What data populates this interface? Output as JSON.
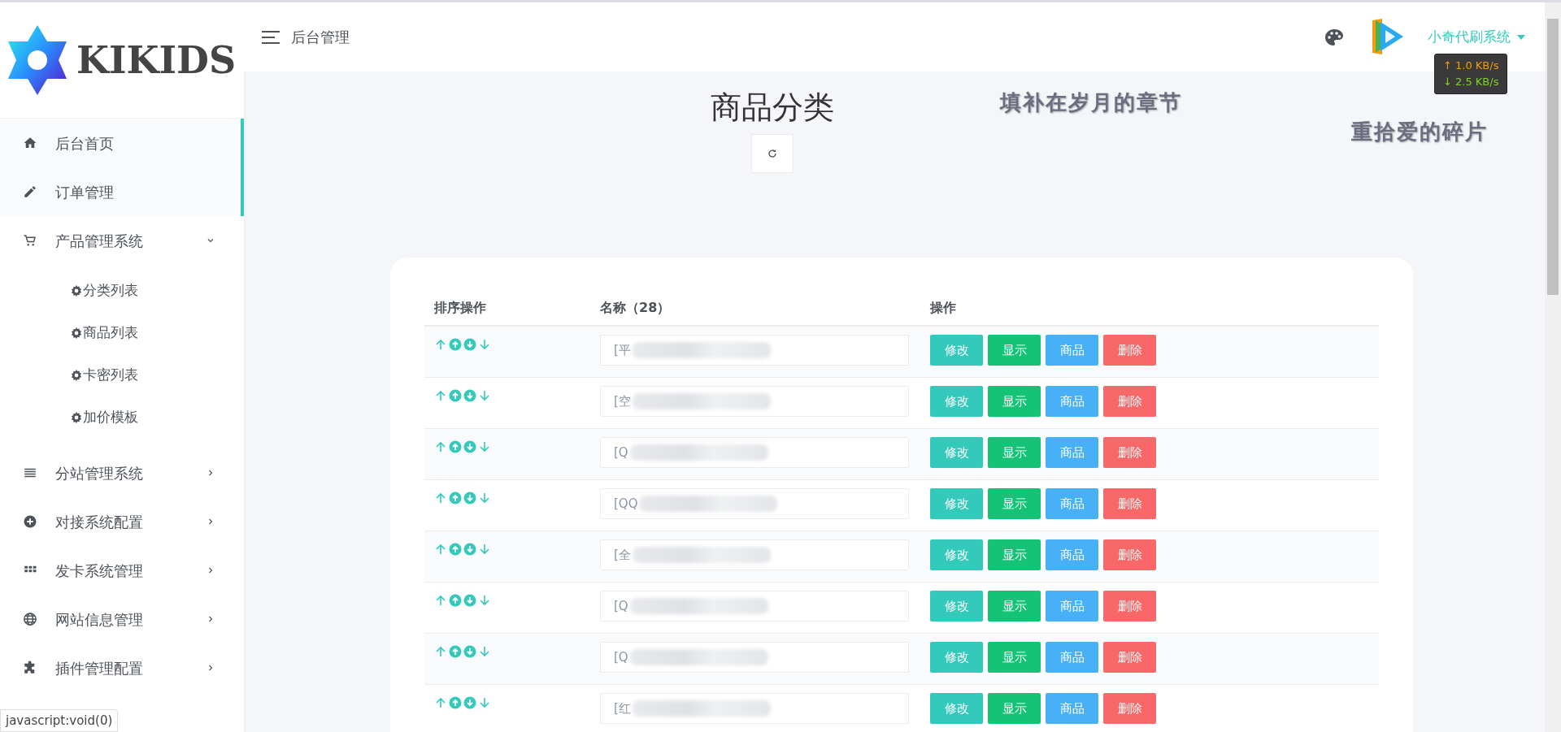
{
  "sidebar": {
    "logo": "KIKIDS",
    "items": [
      {
        "label": "后台首页",
        "selected": true
      },
      {
        "label": "订单管理",
        "selected": true
      },
      {
        "label": "产品管理系统",
        "selected": false,
        "expanded": true,
        "children": [
          {
            "label": "分类列表"
          },
          {
            "label": "商品列表"
          },
          {
            "label": "卡密列表"
          },
          {
            "label": "加价模板"
          }
        ]
      },
      {
        "label": "分站管理系统",
        "selected": false,
        "expanded": false
      },
      {
        "label": "对接系统配置",
        "selected": false,
        "expanded": false
      },
      {
        "label": "发卡系统管理",
        "selected": false,
        "expanded": false
      },
      {
        "label": "网站信息管理",
        "selected": false,
        "expanded": false
      },
      {
        "label": "插件管理配置",
        "selected": false,
        "expanded": false
      }
    ]
  },
  "header": {
    "title": "后台管理",
    "user": "小奇代刷系统"
  },
  "net_speed": {
    "upload": "↑ 1.0 KB/s",
    "download": "↓ 2.5 KB/s"
  },
  "page": {
    "title": "商品分类",
    "floating_texts": [
      "填补在岁月的章节",
      "重拾爱的碎片"
    ]
  },
  "table": {
    "columns": [
      "排序操作",
      "名称（28）",
      "操作"
    ],
    "rows": [
      {
        "name": "[平",
        "actions": [
          "修改",
          "显示",
          "商品",
          "删除"
        ]
      },
      {
        "name": "[空",
        "actions": [
          "修改",
          "显示",
          "商品",
          "删除"
        ]
      },
      {
        "name": "[Q",
        "actions": [
          "修改",
          "显示",
          "商品",
          "删除"
        ]
      },
      {
        "name": "[QQ",
        "actions": [
          "修改",
          "显示",
          "商品",
          "删除"
        ]
      },
      {
        "name": "[全",
        "actions": [
          "修改",
          "显示",
          "商品",
          "删除"
        ]
      },
      {
        "name": "[Q",
        "actions": [
          "修改",
          "显示",
          "商品",
          "删除"
        ]
      },
      {
        "name": "[Q",
        "actions": [
          "修改",
          "显示",
          "商品",
          "删除"
        ]
      },
      {
        "name": "[红",
        "actions": [
          "修改",
          "显示",
          "商品",
          "删除"
        ]
      }
    ]
  },
  "status_bar": "javascript:void(0)"
}
